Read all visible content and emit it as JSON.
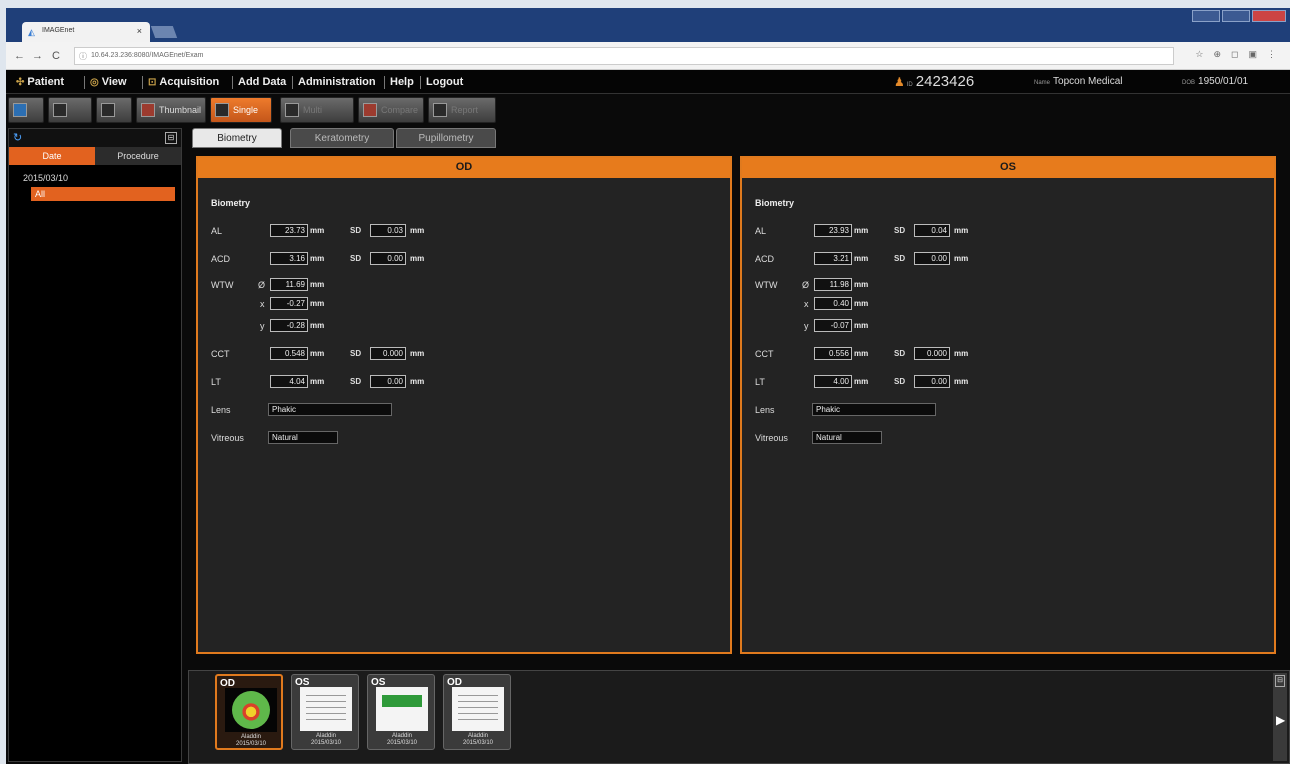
{
  "browser": {
    "tab_title": "IMAGEnet",
    "tab_close": "×",
    "url": "10.64.23.236:8080/IMAGEnet/Exam",
    "nav_back": "←",
    "nav_forward": "→",
    "nav_reload": "C",
    "url_icon": "ⓘ",
    "ext_icons": [
      "☆",
      "⊕",
      "◻",
      "▣",
      "⋮"
    ]
  },
  "menu": {
    "items": [
      {
        "label": "Patient",
        "icon": "✣"
      },
      {
        "label": "View",
        "icon": "◎"
      },
      {
        "label": "Acquisition",
        "icon": "⊡"
      },
      {
        "label": "Add Data",
        "icon": ""
      },
      {
        "label": "Administration",
        "icon": ""
      },
      {
        "label": "Help",
        "icon": ""
      },
      {
        "label": "Logout",
        "icon": ""
      }
    ],
    "patient_id": "2423426",
    "patient_id_label": "ID",
    "patient_name_label": "Name",
    "patient_name": "Topcon Medical",
    "dob_label": "DOB",
    "dob": "1950/01/01"
  },
  "toolbar": {
    "thumbnail_label": "Thumbnail",
    "single_label": "Single",
    "multi_label": "Multi",
    "compare_label": "Compare",
    "report_label": "Report"
  },
  "left_panel": {
    "refresh_icon": "↻",
    "collapse_icon": "⊟",
    "tab_date": "Date",
    "tab_procedure": "Procedure",
    "date_entry": "2015/03/10",
    "all_label": "All"
  },
  "main_tabs": [
    "Biometry",
    "Keratometry",
    "Pupillometry"
  ],
  "od": {
    "header": "OD",
    "section": "Biometry",
    "al": "23.73",
    "al_sd": "0.03",
    "acd": "3.16",
    "acd_sd": "0.00",
    "wtw_d": "11.69",
    "wtw_x": "-0.27",
    "wtw_y": "-0.28",
    "cct": "0.548",
    "cct_sd": "0.000",
    "lt": "4.04",
    "lt_sd": "0.00",
    "lens": "Phakic",
    "vitreous": "Natural"
  },
  "os": {
    "header": "OS",
    "section": "Biometry",
    "al": "23.93",
    "al_sd": "0.04",
    "acd": "3.21",
    "acd_sd": "0.00",
    "wtw_d": "11.98",
    "wtw_x": "0.40",
    "wtw_y": "-0.07",
    "cct": "0.556",
    "cct_sd": "0.000",
    "lt": "4.00",
    "lt_sd": "0.00",
    "lens": "Phakic",
    "vitreous": "Natural"
  },
  "labels": {
    "al": "AL",
    "acd": "ACD",
    "wtw": "WTW",
    "cct": "CCT",
    "lt": "LT",
    "lens": "Lens",
    "vitreous": "Vitreous",
    "sd": "SD",
    "mm": "mm",
    "diam": "Ø",
    "x": "x",
    "y": "y"
  },
  "thumbnails": [
    {
      "tag": "OD",
      "caption_top": "Aladdin",
      "caption_date": "2015/03/10",
      "kind": "map",
      "selected": true
    },
    {
      "tag": "OS",
      "caption_top": "Aladdin",
      "caption_date": "2015/03/10",
      "kind": "doc",
      "selected": false
    },
    {
      "tag": "OS",
      "caption_top": "Aladdin",
      "caption_date": "2015/03/10",
      "kind": "chart",
      "selected": false
    },
    {
      "tag": "OD",
      "caption_top": "Aladdin",
      "caption_date": "2015/03/10",
      "kind": "doc",
      "selected": false
    }
  ],
  "strip": {
    "collapse_icon": "⊟",
    "next_icon": "▶"
  }
}
